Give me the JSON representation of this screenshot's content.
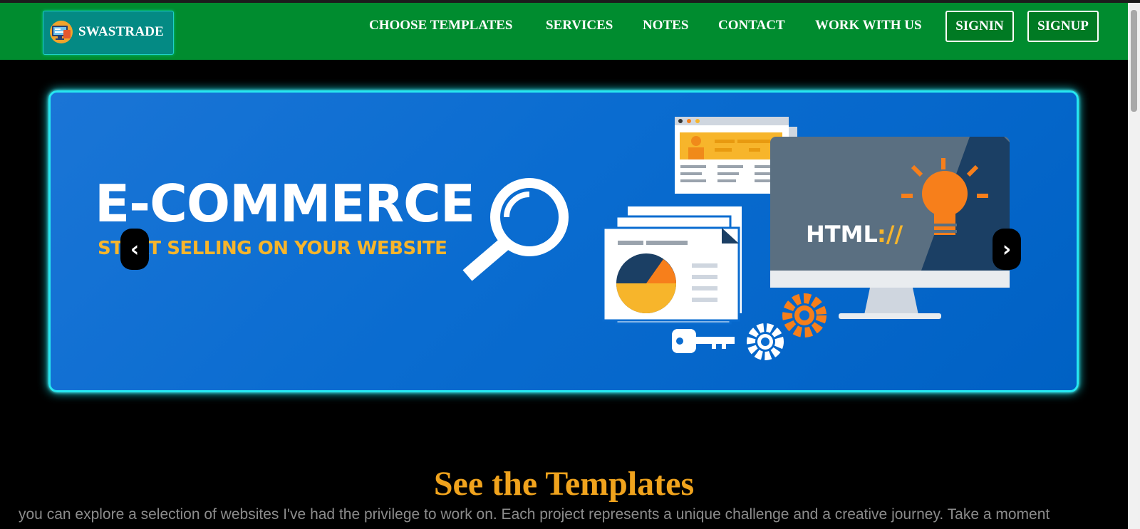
{
  "brand": {
    "name": "SWASTRADE",
    "icon": "computer-logo-icon"
  },
  "nav": {
    "links": [
      "CHOOSE TEMPLATES",
      "SERVICES",
      "NOTES",
      "CONTACT",
      "WORK WITH US"
    ],
    "signin_label": "SIGNIN",
    "signup_label": "SIGNUP"
  },
  "carousel": {
    "slide_title": "E-COMMERCE",
    "slide_subtitle": "START SELLING ON YOUR WEBSITE",
    "art_badge": "HTML://",
    "prev_label": "‹",
    "next_label": "›"
  },
  "section": {
    "title": "See the Templates",
    "text": "you can explore a selection of websites I've had the privilege to work on. Each project represents a unique challenge and a creative journey. Take a moment"
  },
  "colors": {
    "nav_bg": "#008c2f",
    "accent_gold": "#f0a31d",
    "carousel_glow": "#27e7f0",
    "carousel_bg": "#0a6cd0"
  }
}
